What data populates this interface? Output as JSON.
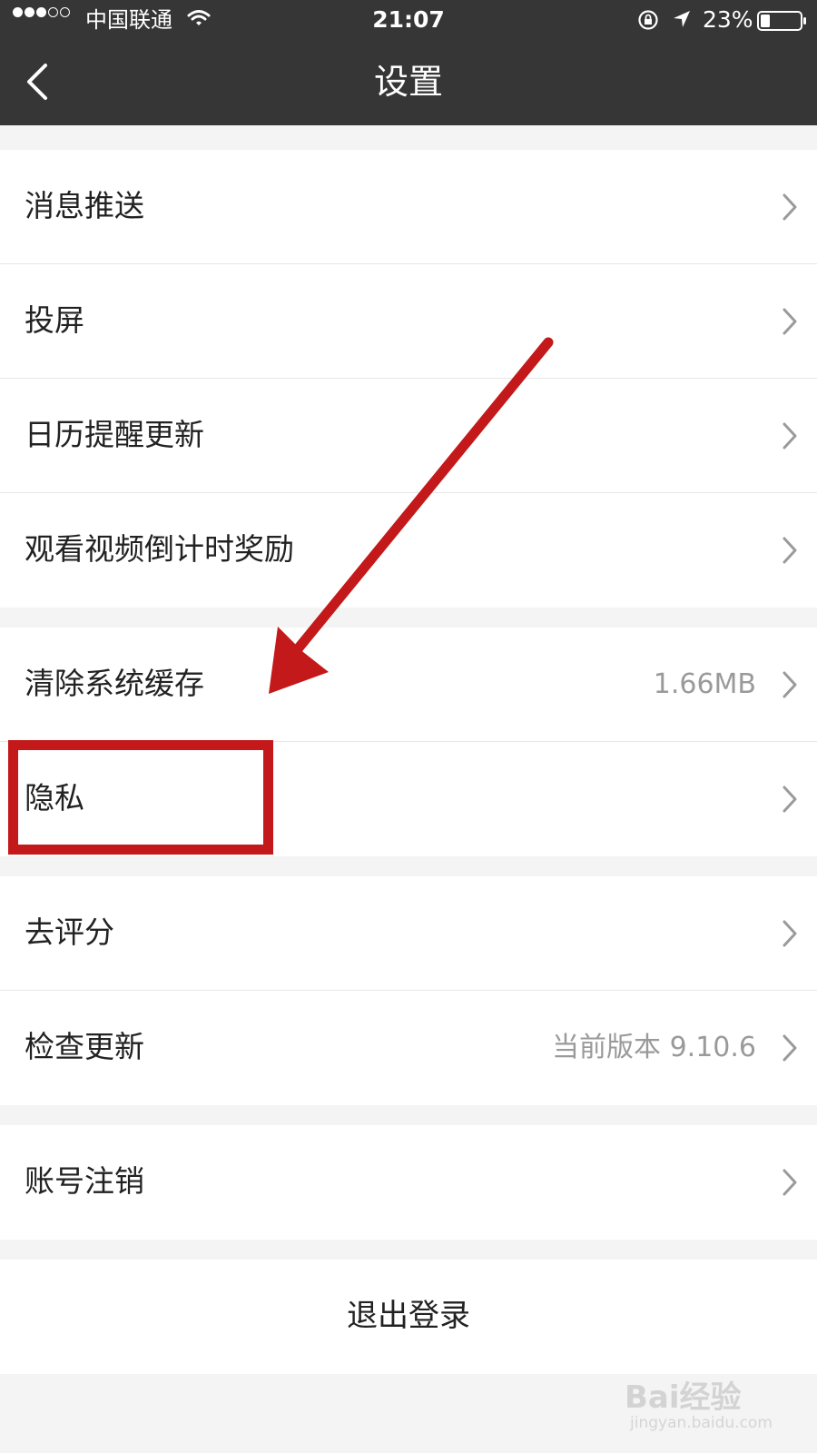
{
  "status_bar": {
    "carrier": "中国联通",
    "time": "21:07",
    "battery": "23%",
    "signal_bars": 3,
    "signal_total": 5
  },
  "navbar": {
    "title": "设置",
    "back_icon": "chevron-left-icon"
  },
  "groups": [
    {
      "items": [
        {
          "label": "消息推送"
        },
        {
          "label": "投屏"
        },
        {
          "label": "日历提醒更新"
        },
        {
          "label": "观看视频倒计时奖励"
        }
      ]
    },
    {
      "items": [
        {
          "label": "清除系统缓存",
          "value": "1.66MB"
        },
        {
          "label": "隐私"
        }
      ]
    },
    {
      "items": [
        {
          "label": "去评分"
        },
        {
          "label": "检查更新",
          "value": "当前版本 9.10.6"
        }
      ]
    },
    {
      "items": [
        {
          "label": "账号注销"
        }
      ]
    }
  ],
  "logout": {
    "label": "退出登录"
  },
  "annotation": {
    "color": "#c3191a",
    "highlighted_item": "隐私"
  },
  "watermark": {
    "logo": "Bai经验",
    "url": "jingyan.baidu.com"
  }
}
